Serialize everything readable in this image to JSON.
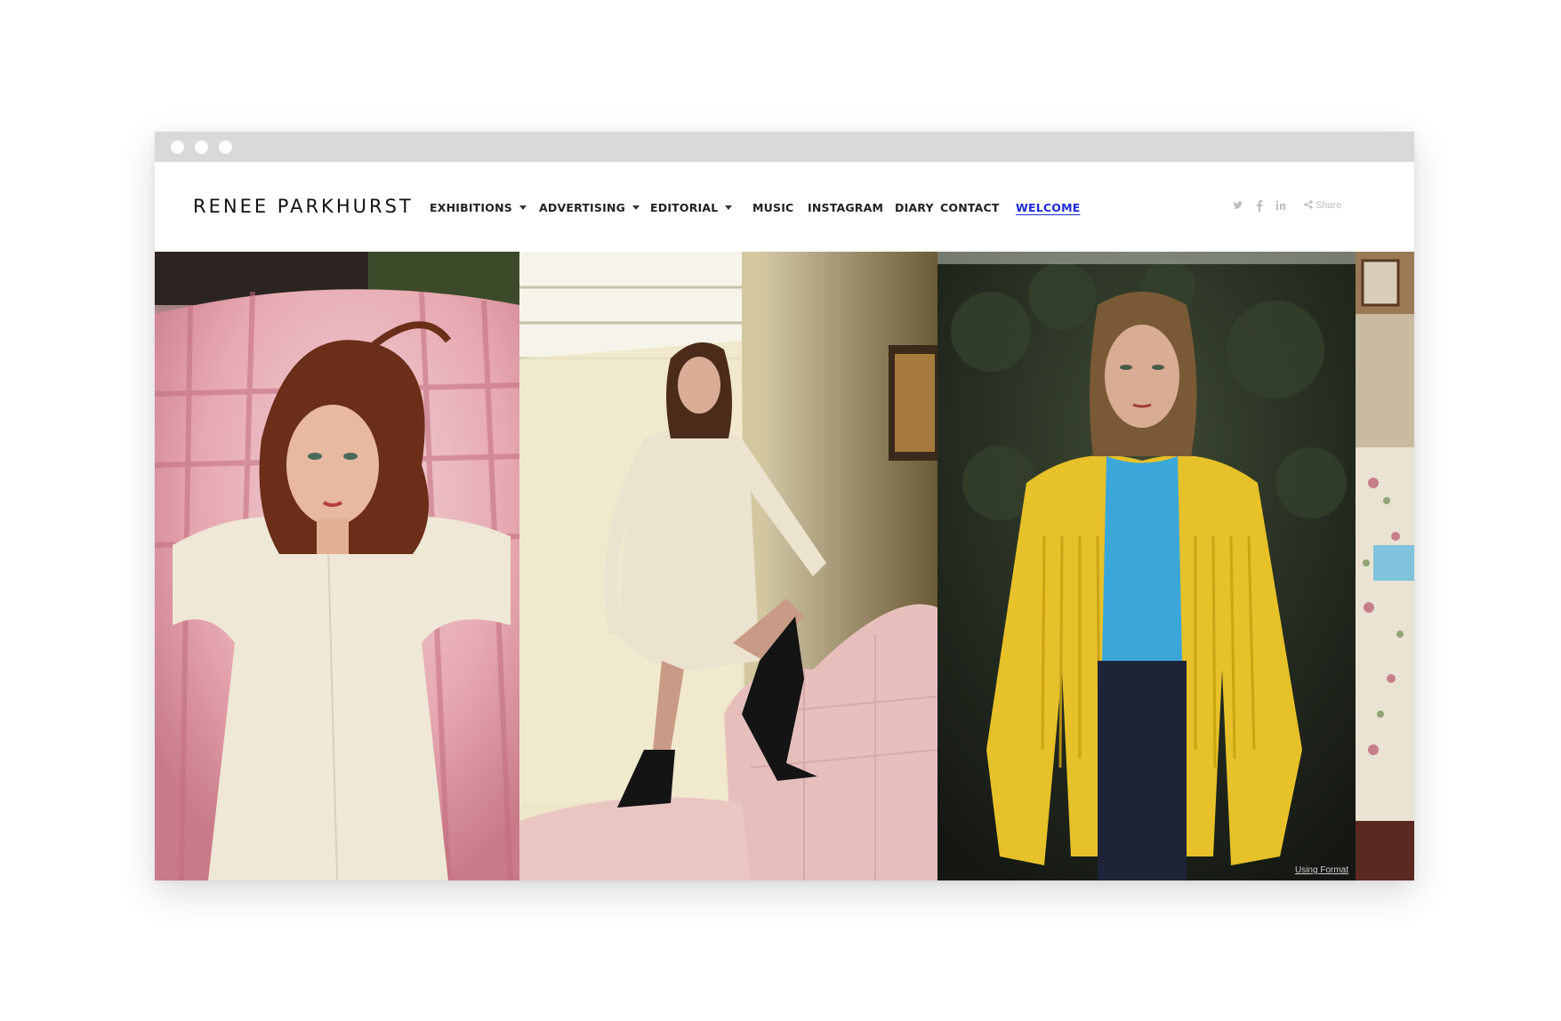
{
  "site": {
    "logo": "RENEE PARKHURST"
  },
  "nav": {
    "items": [
      {
        "label": "EXHIBITIONS",
        "dropdown": true
      },
      {
        "label": "ADVERTISING",
        "dropdown": true
      },
      {
        "label": "EDITORIAL",
        "dropdown": true
      },
      {
        "label": "MUSIC",
        "dropdown": false
      },
      {
        "label": "INSTAGRAM",
        "dropdown": false
      },
      {
        "label": "DIARY",
        "dropdown": false
      },
      {
        "label": "CONTACT",
        "dropdown": false
      },
      {
        "label": "WELCOME",
        "dropdown": false,
        "active": true
      }
    ]
  },
  "social": {
    "twitter": "twitter-icon",
    "facebook": "facebook-icon",
    "linkedin": "linkedin-icon",
    "share_label": "Share"
  },
  "gallery": {
    "credit": "Using Format"
  },
  "colors": {
    "active_link": "#1d2bd8",
    "titlebar": "#d9d9d9"
  }
}
